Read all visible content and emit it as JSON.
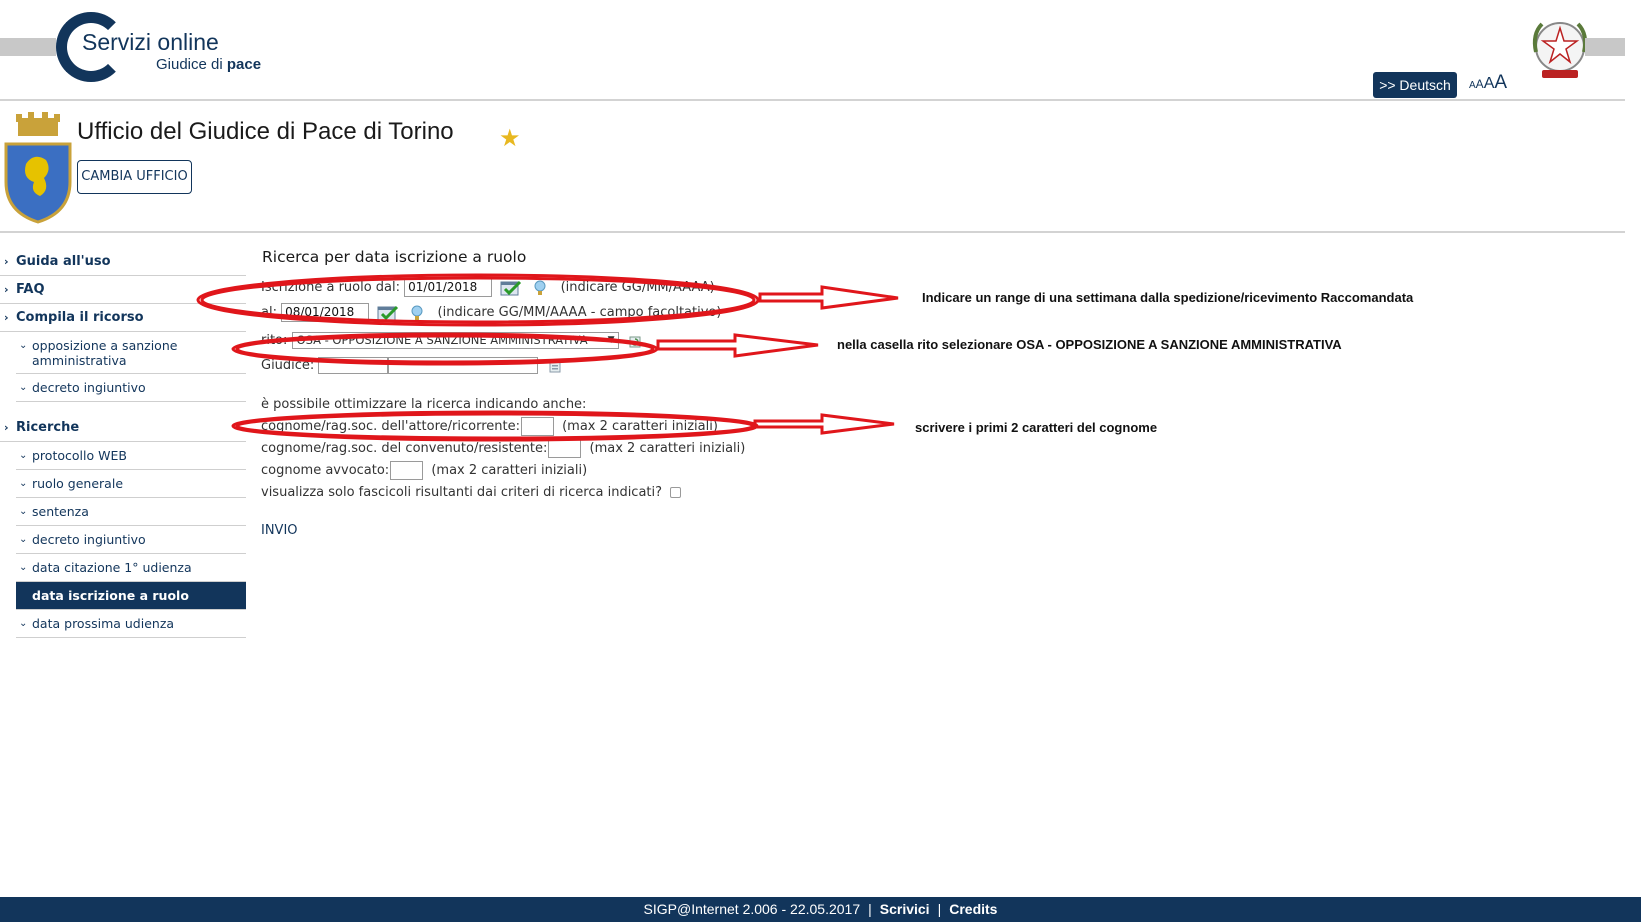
{
  "header": {
    "logo_line1": "Servizi online",
    "logo_line2_prefix": "Giudice di",
    "logo_line2_bold": "pace",
    "lang_button": ">> Deutsch",
    "font_sizes": [
      "A",
      "A",
      "A",
      "A"
    ]
  },
  "office": {
    "title": "Ufficio del Giudice di Pace di Torino",
    "change_button": "CAMBIA UFFICIO"
  },
  "sidebar": {
    "items": [
      {
        "label": "Guida all'uso"
      },
      {
        "label": "FAQ"
      },
      {
        "label": "Compila il ricorso"
      },
      {
        "label": "opposizione a sanzione amministrativa"
      },
      {
        "label": "decreto ingiuntivo"
      },
      {
        "label": "Ricerche"
      },
      {
        "label": "protocollo WEB"
      },
      {
        "label": "ruolo generale"
      },
      {
        "label": "sentenza"
      },
      {
        "label": "decreto ingiuntivo"
      },
      {
        "label": "data citazione 1° udienza"
      },
      {
        "label": "data iscrizione a ruolo"
      },
      {
        "label": "data prossima udienza"
      }
    ]
  },
  "form": {
    "title": "Ricerca per data iscrizione a ruolo",
    "from_label": "Iscrizione a ruolo dal:",
    "from_value": "01/01/2018",
    "from_hint": "(indicare GG/MM/AAAA)",
    "to_label": "al:",
    "to_value": "08/01/2018",
    "to_hint": "(indicare GG/MM/AAAA - campo facoltativo)",
    "rito_label": "rito:",
    "rito_value": "OSA - OPPOSIZIONE A SANZIONE AMMINISTRATIVA",
    "giudice_label": "Giudice:",
    "optimize_text": "è possibile ottimizzare la ricerca indicando anche:",
    "attore_label": "cognome/rag.soc. dell'attore/ricorrente:",
    "convenuto_label": "cognome/rag.soc. del convenuto/resistente:",
    "avvocato_label": "cognome avvocato:",
    "max_hint": "(max 2 caratteri iniziali)",
    "filter_label": "visualizza solo fascicoli risultanti dai criteri di ricerca indicati?",
    "submit": "INVIO"
  },
  "annotations": {
    "note1": "Indicare un range di una settimana dalla spedizione/ricevimento Raccomandata",
    "note2": "nella casella rito selezionare OSA - OPPOSIZIONE A SANZIONE AMMINISTRATIVA",
    "note3": "scrivere i primi 2 caratteri del cognome",
    "color": "#e0161b"
  },
  "footer": {
    "version": "SIGP@Internet 2.006 - 22.05.2017",
    "link1": "Scrivici",
    "link2": "Credits"
  },
  "colors": {
    "brand": "#12355b",
    "star": "#e8b820"
  }
}
